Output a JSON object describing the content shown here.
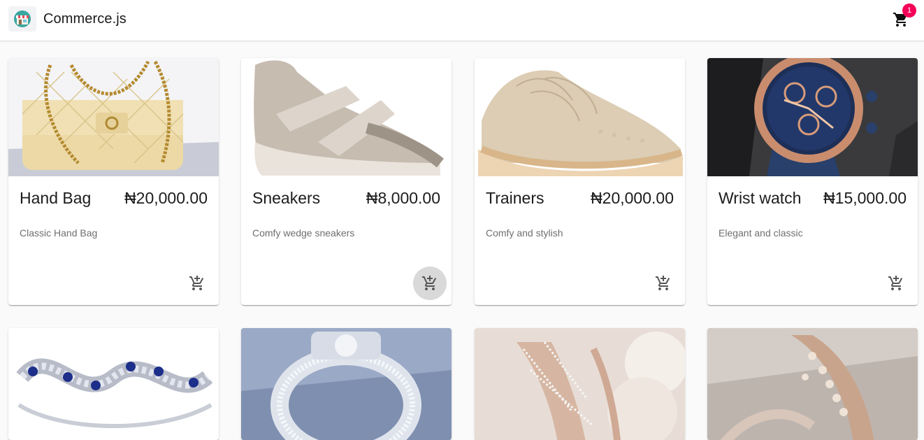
{
  "app": {
    "title": "Commerce.js",
    "cart_count": "1",
    "icons": {
      "logo": "store-logo-icon",
      "cart": "shopping-cart-icon",
      "add_to_cart": "add-shopping-cart-icon"
    },
    "colors": {
      "badge": "#f50057",
      "appbar": "#ffffff",
      "background": "#fafafa"
    }
  },
  "products": [
    {
      "name": "Hand Bag",
      "price": "₦20,000.00",
      "description": "Classic Hand Bag"
    },
    {
      "name": "Sneakers",
      "price": "₦8,000.00",
      "description": "Comfy wedge sneakers"
    },
    {
      "name": "Trainers",
      "price": "₦20,000.00",
      "description": "Comfy and stylish"
    },
    {
      "name": "Wrist watch",
      "price": "₦15,000.00",
      "description": "Elegant and classic"
    }
  ]
}
